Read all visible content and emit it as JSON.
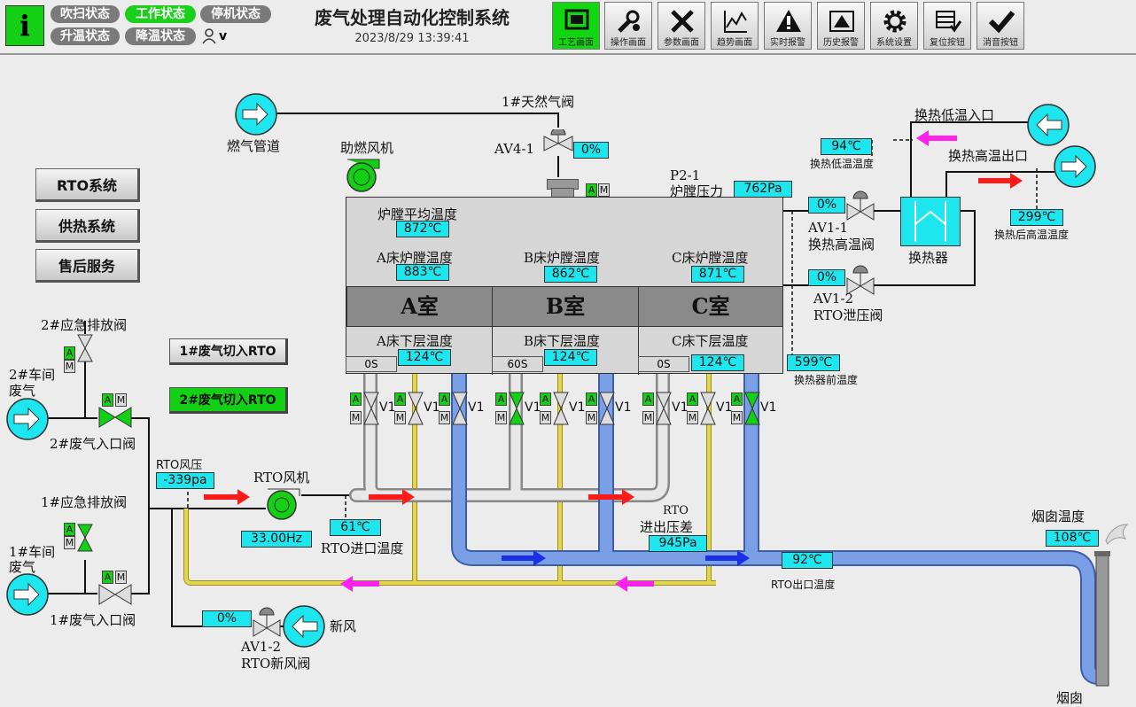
{
  "header": {
    "title": "废气处理自动化控制系统",
    "datetime": "2023/8/29 13:39:41",
    "info_icon": "i",
    "user": "v",
    "states": [
      "吹扫状态",
      "工作状态",
      "停机状态",
      "升温状态",
      "降温状态"
    ],
    "active_state": "工作状态",
    "toolbar": [
      "工艺画面",
      "操作画面",
      "参数画面",
      "趋势画面",
      "实时报警",
      "历史报警",
      "系统设置",
      "复位按钮",
      "消音按钮"
    ]
  },
  "side_buttons": [
    "RTO系统",
    "供热系统",
    "售后服务"
  ],
  "switch_buttons": {
    "b1": "1#废气切入RTO",
    "b2": "2#废气切入RTO"
  },
  "labels": {
    "gas_valve": "1#天然气阀",
    "gas_pipe": "燃气管道",
    "burner_fan": "助燃风机",
    "av41": "AV4-1",
    "p21": "P2-1",
    "furnace_pressure": "炉膛压力",
    "furnace_avg_temp": "炉膛平均温度",
    "a_temp": "A床炉膛温度",
    "b_temp": "B床炉膛温度",
    "c_temp": "C床炉膛温度",
    "room_a": "A室",
    "room_b": "B室",
    "room_c": "C室",
    "a_lower": "A床下层温度",
    "b_lower": "B床下层温度",
    "c_lower": "C床下层温度",
    "hx_low_in": "换热低温入口",
    "hx_high_out": "换热高温出口",
    "hx_low_temp": "换热低温温度",
    "hx_after": "换热后高温温度",
    "av11": "AV1-1",
    "av11_name": "换热高温阀",
    "hx": "换热器",
    "av12a": "AV1-2",
    "av12a_name": "RTO泄压阀",
    "hx_before": "换热器前温度",
    "emergency2": "2#应急排放阀",
    "ws2_a": "2#车间",
    "ws2_b": "废气",
    "inlet2": "2#废气入口阀",
    "rto_wind_pressure": "RTO风压",
    "rto_fan": "RTO风机",
    "emergency1": "1#应急排放阀",
    "ws1_a": "1#车间",
    "ws1_b": "废气",
    "inlet1": "1#废气入口阀",
    "rto_inlet_temp": "RTO进口温度",
    "rto_diff_a": "RTO",
    "rto_diff_b": "进出压差",
    "rto_outlet_temp": "RTO出口温度",
    "chimney_temp": "烟囱温度",
    "chimney": "烟囱",
    "fresh_air": "新风",
    "av12b": "AV1-2",
    "av12b_name": "RTO新风阀",
    "v1": "V1",
    "a": "A",
    "m": "M"
  },
  "values": {
    "av41_open": "0%",
    "furnace_pressure": "762Pa",
    "furnace_avg_temp": "872℃",
    "a_temp": "883℃",
    "b_temp": "862℃",
    "c_temp": "871℃",
    "a_lower": "124℃",
    "b_lower": "124℃",
    "c_lower": "124℃",
    "a_timer": "0S",
    "b_timer": "60S",
    "c_timer": "0S",
    "hx_low_temp": "94℃",
    "hx_after": "299℃",
    "av11_open": "0%",
    "av12a_open": "0%",
    "hx_before": "599℃",
    "rto_wind_pressure": "-339pa",
    "fan_freq": "33.00Hz",
    "rto_inlet_temp": "61℃",
    "rto_diff": "945Pa",
    "rto_outlet_temp": "92℃",
    "chimney_temp": "108℃",
    "av12b_open": "0%"
  },
  "colors": {
    "green": "#14d014",
    "cyan": "#1ee6ef",
    "blue_pipe": "#7b9fe6",
    "yellow_pipe": "#e4d64a",
    "red_arrow": "#ff1a1a",
    "magenta_arrow": "#ff22ee"
  }
}
